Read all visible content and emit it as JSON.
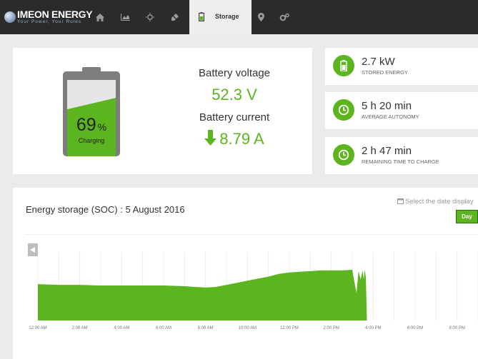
{
  "brand": {
    "title": "IMEON ENERGY",
    "tagline": "Your Power, Your Rules"
  },
  "nav": {
    "icons": [
      "home-icon",
      "chart-icon",
      "sun-icon",
      "plug-icon",
      "battery-icon",
      "map-marker-icon",
      "cogs-icon"
    ],
    "active_tab": "Storage"
  },
  "battery": {
    "percent": "69",
    "percent_unit": "%",
    "percent_value": 69,
    "status": "Charging"
  },
  "voltage": {
    "label": "Battery voltage",
    "value": "52.3 V"
  },
  "current": {
    "label": "Battery current",
    "value": "8.79 A",
    "direction": "down"
  },
  "stats": [
    {
      "value": "2.7 kW",
      "label": "STORED ENERGY",
      "icon": "battery-icon"
    },
    {
      "value": "5 h 20 min",
      "label": "AVERAGE AUTONOMY",
      "icon": "clock-icon"
    },
    {
      "value": "2 h 47 min",
      "label": "REMAINING TIME TO CHARGE",
      "icon": "clock-icon"
    }
  ],
  "chart_section": {
    "title": "Energy storage (SOC) : 5 August 2016",
    "date_hint": "Select the date display",
    "day_button": "Day"
  },
  "colors": {
    "accent": "#5cb41e",
    "nav_bg": "#2b2b2b",
    "page_bg": "#ebebeb"
  },
  "chart_data": {
    "type": "area",
    "title": "Energy storage (SOC) : 5 August 2016",
    "x_ticks": [
      "12:00 AM",
      "2:00 AM",
      "4:00 AM",
      "6:00 AM",
      "8:00 AM",
      "10:00 AM",
      "12:00 PM",
      "2:00 PM",
      "4:00 PM",
      "6:00 PM",
      "8:00 PM"
    ],
    "x_range_hours": [
      0,
      21
    ],
    "ylim": [
      0,
      100
    ],
    "grid": true,
    "series": [
      {
        "x": [
          0,
          1,
          2,
          3,
          4,
          5,
          6,
          7,
          7.5,
          8,
          8.5,
          9,
          9.5,
          10,
          10.5,
          11,
          11.5,
          12,
          12.5,
          13,
          13.5,
          14,
          14.5,
          15,
          15.2,
          15.3,
          15.4,
          15.5,
          15.55,
          15.6,
          15.65,
          15.7
        ],
        "y": [
          53,
          52,
          52,
          51,
          51,
          51,
          51,
          50,
          49,
          48,
          49,
          52,
          55,
          58,
          61,
          64,
          68,
          70,
          71,
          72,
          73,
          73,
          73,
          74,
          40,
          72,
          60,
          73,
          60,
          74,
          62,
          0
        ]
      }
    ]
  }
}
